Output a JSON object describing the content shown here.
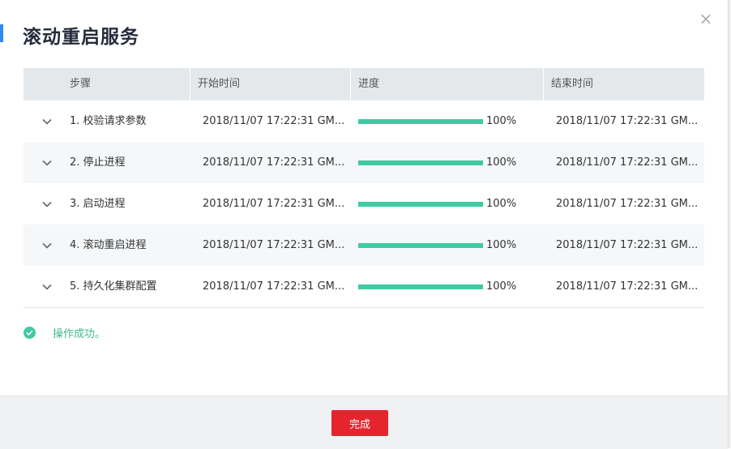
{
  "dialog": {
    "title": "滚动重启服务",
    "close_label": "×"
  },
  "table": {
    "headers": {
      "step": "步骤",
      "start_time": "开始时间",
      "progress": "进度",
      "end_time": "结束时间"
    },
    "rows": [
      {
        "step": "1. 校验请求参数",
        "start_time": "2018/11/07 17:22:31 GM...",
        "progress": 100,
        "progress_label": "100%",
        "end_time": "2018/11/07 17:22:31 GM..."
      },
      {
        "step": "2. 停止进程",
        "start_time": "2018/11/07 17:22:31 GM...",
        "progress": 100,
        "progress_label": "100%",
        "end_time": "2018/11/07 17:22:31 GM..."
      },
      {
        "step": "3. 启动进程",
        "start_time": "2018/11/07 17:22:31 GM...",
        "progress": 100,
        "progress_label": "100%",
        "end_time": "2018/11/07 17:22:31 GM..."
      },
      {
        "step": "4. 滚动重启进程",
        "start_time": "2018/11/07 17:22:31 GM...",
        "progress": 100,
        "progress_label": "100%",
        "end_time": "2018/11/07 17:22:31 GM..."
      },
      {
        "step": "5. 持久化集群配置",
        "start_time": "2018/11/07 17:22:31 GM...",
        "progress": 100,
        "progress_label": "100%",
        "end_time": "2018/11/07 17:22:31 GM..."
      }
    ]
  },
  "status": {
    "icon": "check-circle-icon",
    "message": "操作成功。"
  },
  "footer": {
    "done_label": "完成"
  },
  "colors": {
    "accent": "#2d8cf0",
    "progress": "#3fcaa2",
    "success_text": "#3fbb93",
    "primary_button": "#e5242d"
  }
}
